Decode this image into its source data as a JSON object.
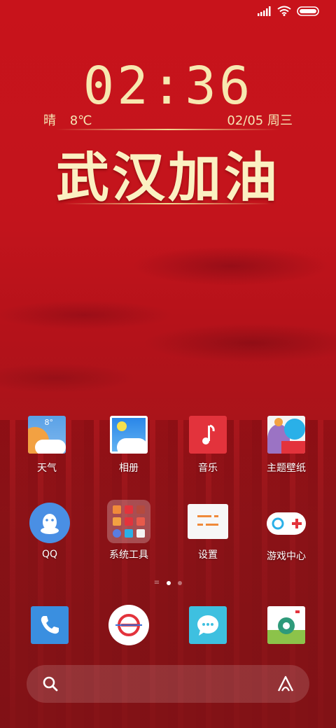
{
  "clock": {
    "time": "02:36"
  },
  "weather": {
    "condition": "晴",
    "temp": "8℃"
  },
  "date": {
    "text": "02/05 周三"
  },
  "slogan": "武汉加油",
  "apps": {
    "weather": {
      "label": "天气",
      "temp_badge": "8°"
    },
    "gallery": {
      "label": "相册"
    },
    "music": {
      "label": "音乐"
    },
    "themes": {
      "label": "主题壁纸"
    },
    "qq": {
      "label": "QQ"
    },
    "system_tools": {
      "label": "系统工具"
    },
    "settings": {
      "label": "设置"
    },
    "game_center": {
      "label": "游戏中心"
    }
  },
  "colors": {
    "background": "#c8131b",
    "clock": "#f7e8b0",
    "slogan": "#fbf0c2"
  }
}
